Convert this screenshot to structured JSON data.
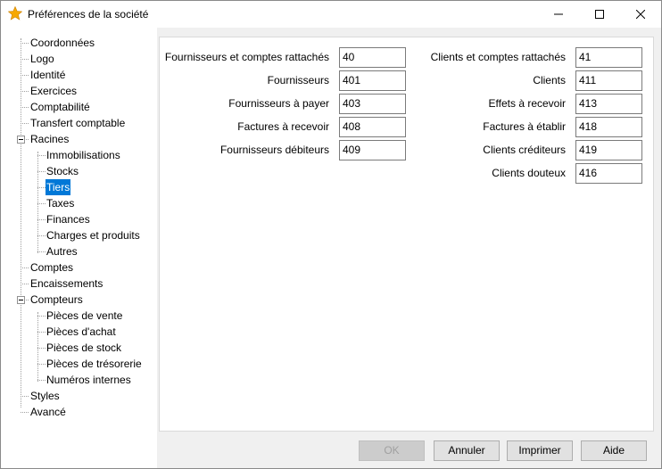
{
  "window": {
    "title": "Préférences de la société",
    "icon": "star-icon",
    "accent": "#0078d7"
  },
  "tree": {
    "items": [
      {
        "label": "Coordonnées",
        "level": 0
      },
      {
        "label": "Logo",
        "level": 0
      },
      {
        "label": "Identité",
        "level": 0
      },
      {
        "label": "Exercices",
        "level": 0
      },
      {
        "label": "Comptabilité",
        "level": 0
      },
      {
        "label": "Transfert comptable",
        "level": 0
      },
      {
        "label": "Racines",
        "level": 0,
        "expanded": true
      },
      {
        "label": "Immobilisations",
        "level": 1
      },
      {
        "label": "Stocks",
        "level": 1
      },
      {
        "label": "Tiers",
        "level": 1,
        "selected": true
      },
      {
        "label": "Taxes",
        "level": 1
      },
      {
        "label": "Finances",
        "level": 1
      },
      {
        "label": "Charges et produits",
        "level": 1
      },
      {
        "label": "Autres",
        "level": 1
      },
      {
        "label": "Comptes",
        "level": 0
      },
      {
        "label": "Encaissements",
        "level": 0
      },
      {
        "label": "Compteurs",
        "level": 0,
        "expanded": true
      },
      {
        "label": "Pièces de vente",
        "level": 1
      },
      {
        "label": "Pièces d'achat",
        "level": 1
      },
      {
        "label": "Pièces de stock",
        "level": 1
      },
      {
        "label": "Pièces de trésorerie",
        "level": 1
      },
      {
        "label": "Numéros internes",
        "level": 1
      },
      {
        "label": "Styles",
        "level": 0
      },
      {
        "label": "Avancé",
        "level": 0
      }
    ]
  },
  "form": {
    "left": [
      {
        "label": "Fournisseurs et comptes rattachés",
        "value": "40"
      },
      {
        "label": "Fournisseurs",
        "value": "401"
      },
      {
        "label": "Fournisseurs à payer",
        "value": "403"
      },
      {
        "label": "Factures à recevoir",
        "value": "408"
      },
      {
        "label": "Fournisseurs débiteurs",
        "value": "409"
      }
    ],
    "right": [
      {
        "label": "Clients et comptes rattachés",
        "value": "41"
      },
      {
        "label": "Clients",
        "value": "411"
      },
      {
        "label": "Effets à recevoir",
        "value": "413"
      },
      {
        "label": "Factures à établir",
        "value": "418"
      },
      {
        "label": "Clients créditeurs",
        "value": "419"
      },
      {
        "label": "Clients douteux",
        "value": "416"
      }
    ]
  },
  "buttons": {
    "ok": "OK",
    "cancel": "Annuler",
    "print": "Imprimer",
    "help": "Aide"
  }
}
